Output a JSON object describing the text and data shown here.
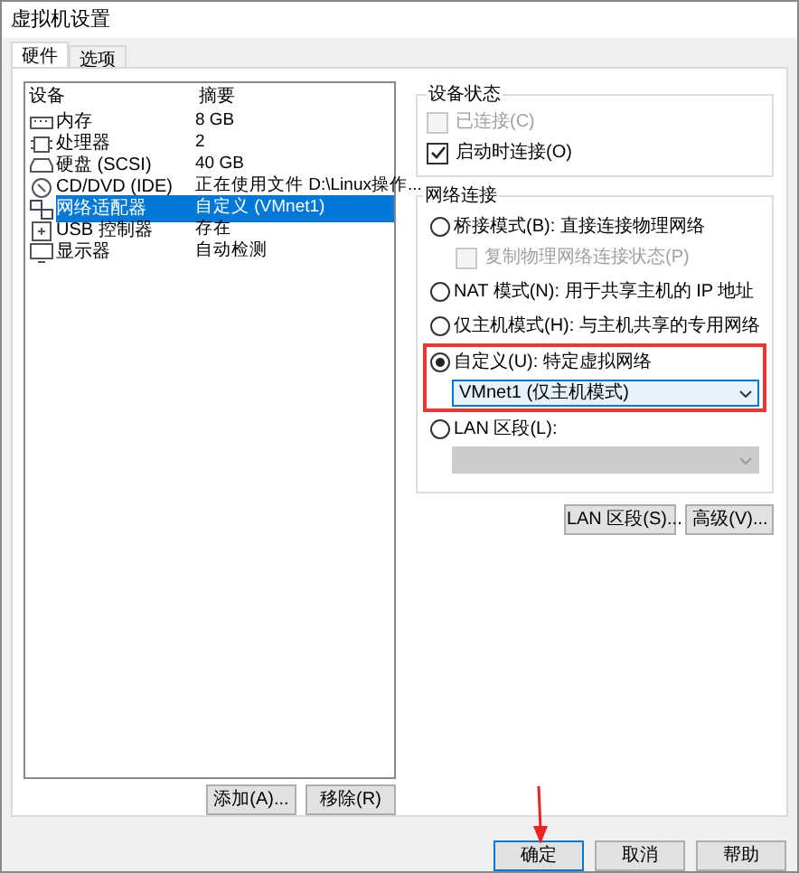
{
  "window": {
    "title": "虚拟机设置"
  },
  "tabs": [
    {
      "label": "硬件",
      "selected": true
    },
    {
      "label": "选项",
      "selected": false
    }
  ],
  "device_table": {
    "columns": [
      "设备",
      "摘要"
    ],
    "rows": [
      {
        "device": "内存",
        "summary": "8 GB",
        "selected": false
      },
      {
        "device": "处理器",
        "summary": "2",
        "selected": false
      },
      {
        "device": "硬盘 (SCSI)",
        "summary": "40 GB",
        "selected": false
      },
      {
        "device": "CD/DVD (IDE)",
        "summary": "正在使用文件 D:\\Linux操作...",
        "selected": false
      },
      {
        "device": "网络适配器",
        "summary": "自定义 (VMnet1)",
        "selected": true
      },
      {
        "device": "USB 控制器",
        "summary": "存在",
        "selected": false
      },
      {
        "device": "显示器",
        "summary": "自动检测",
        "selected": false
      }
    ]
  },
  "list_buttons": [
    "添加(A)...",
    "移除(R)"
  ],
  "device_status": {
    "title": "设备状态",
    "options": [
      {
        "label": "已连接(C)",
        "checked": false,
        "disabled": true
      },
      {
        "label": "启动时连接(O)",
        "checked": true,
        "disabled": false
      }
    ]
  },
  "network": {
    "title": "网络连接",
    "options": [
      {
        "label": "桥接模式(B): 直接连接物理网络",
        "selected": false,
        "highlighted": false,
        "checkbox": {
          "label": "复制物理网络连接状态(P)",
          "checked": false,
          "disabled": true
        }
      },
      {
        "label": "NAT 模式(N): 用于共享主机的 IP 地址",
        "selected": false,
        "highlighted": false
      },
      {
        "label": "仅主机模式(H): 与主机共享的专用网络",
        "selected": false,
        "highlighted": false
      },
      {
        "label": "自定义(U): 特定虚拟网络",
        "selected": true,
        "highlighted": true,
        "dropdown": {
          "value": "VMnet1 (仅主机模式)",
          "disabled": false
        }
      },
      {
        "label": "LAN 区段(L):",
        "selected": false,
        "highlighted": false,
        "dropdown": {
          "disabled": true
        }
      }
    ]
  },
  "network_buttons": [
    "LAN 区段(S)...",
    "高级(V)..."
  ],
  "dialog_buttons": [
    {
      "label": "确定",
      "default": true
    },
    {
      "label": "取消",
      "default": false
    },
    {
      "label": "帮助",
      "default": false
    }
  ]
}
